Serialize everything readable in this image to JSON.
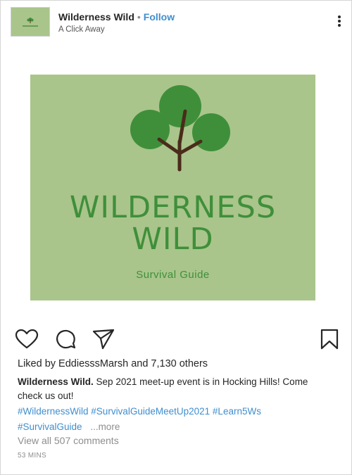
{
  "post": {
    "account_name": "Wilderness Wild",
    "separator": "•",
    "follow_label": "Follow",
    "location": "A Click Away",
    "more_icon": "more-vertical-icon"
  },
  "image": {
    "title_line1": "WILDERNESS",
    "title_line2": "WILD",
    "subtitle": "Survival Guide",
    "colors": {
      "background": "#a9c58b",
      "text": "#3f8f3a",
      "leaves": "#3f8f3a",
      "trunk": "#4a2c1a"
    }
  },
  "actions": {
    "like_icon": "heart-icon",
    "comment_icon": "comment-icon",
    "share_icon": "send-icon",
    "save_icon": "bookmark-icon"
  },
  "likes": {
    "prefix": "Liked by",
    "user": "EddiesssMarsh",
    "suffix": "and 7,130 others"
  },
  "caption": {
    "name": "Wilderness Wild.",
    "text": "Sep 2021 meet-up event is in Hocking Hills! Come check us out!"
  },
  "hashtags": [
    "#WildernessWild",
    "#SurvivalGuideMeetUp2021",
    "#Learn5Ws",
    "#SurvivalGuide"
  ],
  "more_label": "...more",
  "comments_label": "View all 507 comments",
  "timestamp": "53 MINS",
  "colors": {
    "link": "#3f8ecf",
    "muted": "#8e8e8e",
    "text": "#262626"
  }
}
